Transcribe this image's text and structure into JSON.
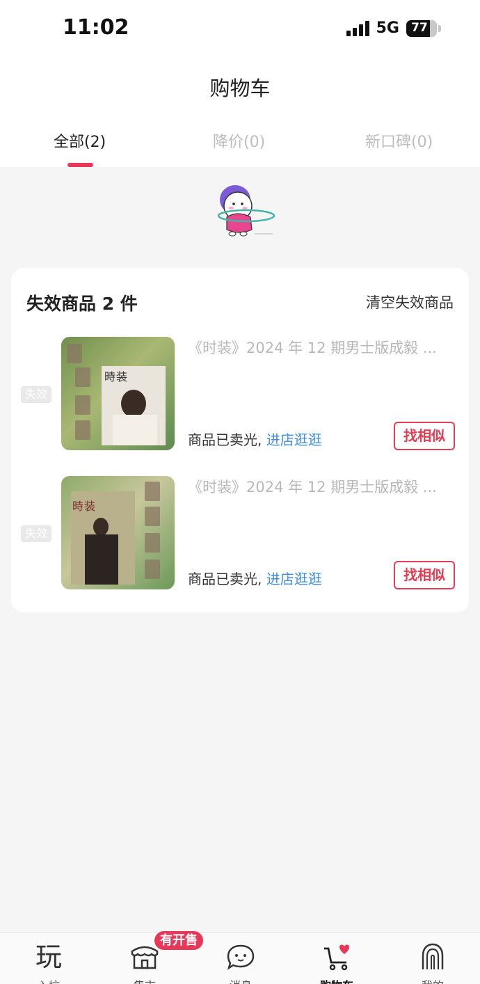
{
  "status_bar": {
    "time": "11:02",
    "network": "5G",
    "battery": "77",
    "battery_level": 0.77
  },
  "header": {
    "title": "购物车"
  },
  "tabs": [
    {
      "label": "全部(2)",
      "active": true
    },
    {
      "label": "降价(0)",
      "active": false
    },
    {
      "label": "新口碑(0)",
      "active": false
    }
  ],
  "invalid_section": {
    "title": "失效商品 2 件",
    "clear_label": "清空失效商品",
    "items": [
      {
        "status_tag": "失效",
        "title": "《时装》2024 年 12 期男士版成毅 ...",
        "sold_out_text": "商品已卖光,",
        "shop_link": "进店逛逛",
        "action_label": "找相似"
      },
      {
        "status_tag": "失效",
        "title": "《时装》2024 年 12 期男士版成毅 ...",
        "sold_out_text": "商品已卖光,",
        "shop_link": "进店逛逛",
        "action_label": "找相似"
      }
    ]
  },
  "bottom_nav": {
    "badge": "有开售",
    "items": [
      {
        "label": "入坑",
        "icon": "play-char-icon"
      },
      {
        "label": "集市",
        "icon": "market-stall-icon"
      },
      {
        "label": "消息",
        "icon": "message-bubble-icon"
      },
      {
        "label": "购物车",
        "icon": "shopping-cart-heart-icon",
        "active": true
      },
      {
        "label": "我的",
        "icon": "fingerprint-icon"
      }
    ]
  },
  "colors": {
    "accent": "#e8385a",
    "link": "#3b8ee6",
    "background": "#f5f5f5"
  }
}
